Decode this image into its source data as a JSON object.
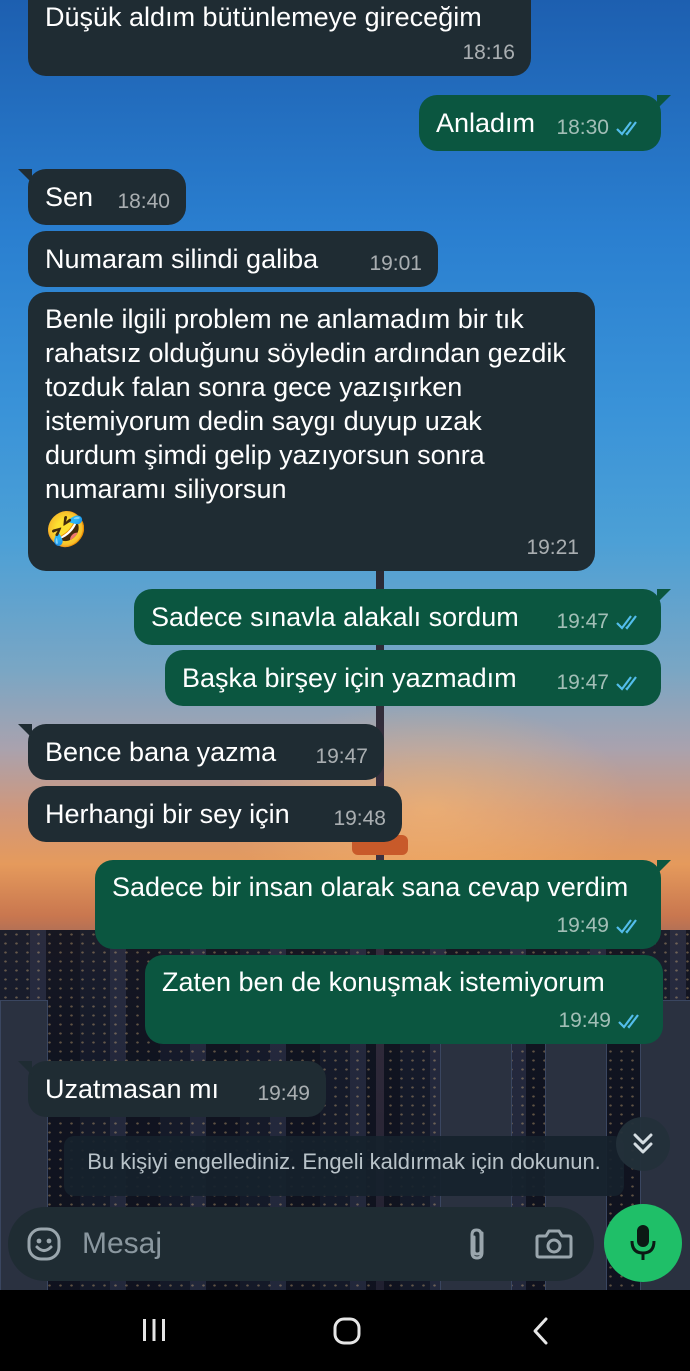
{
  "messages": [
    {
      "side": "in",
      "text": "Düşük aldım bütünlemeye gireceğim",
      "time": "18:16"
    },
    {
      "side": "out",
      "text": "Anladım",
      "time": "18:30",
      "read": true
    },
    {
      "side": "in",
      "text": "Sen",
      "time": "18:40"
    },
    {
      "side": "in",
      "text": "Numaram silindi galiba",
      "time": "19:01"
    },
    {
      "side": "in",
      "text": "Benle ilgili problem ne anlamadım bir tık rahatsız olduğunu söyledin ardından gezdik tozduk falan sonra gece yazışırken istemiyorum dedin saygı duyup uzak durdum şimdi gelip yazıyorsun sonra numaramı siliyorsun",
      "emoji": "🤣",
      "time": "19:21"
    },
    {
      "side": "out",
      "text": "Sadece sınavla alakalı sordum",
      "time": "19:47",
      "read": true
    },
    {
      "side": "out",
      "text": "Başka birşey için yazmadım",
      "time": "19:47",
      "read": true
    },
    {
      "side": "in",
      "text": "Bence bana yazma",
      "time": "19:47"
    },
    {
      "side": "in",
      "text": "Herhangi bir sey için",
      "time": "19:48"
    },
    {
      "side": "out",
      "text": "Sadece bir insan olarak sana cevap verdim",
      "time": "19:49",
      "read": true
    },
    {
      "side": "out",
      "text": "Zaten ben de konuşmak istemiyorum",
      "time": "19:49",
      "read": true
    },
    {
      "side": "in",
      "text": "Uzatmasan mı",
      "time": "19:49"
    }
  ],
  "blocked_notice": "Bu kişiyi engellediniz. Engeli kaldırmak için dokunun.",
  "composer": {
    "placeholder": "Mesaj"
  },
  "icons": {
    "emoji": "emoji-icon",
    "attach": "paperclip-icon",
    "camera": "camera-icon",
    "mic": "mic-icon",
    "scroll": "double-chevron-down-icon",
    "read_receipt": "double-check-icon"
  },
  "colors": {
    "incoming_bubble": "#1f2c33",
    "outgoing_bubble": "#0b5640",
    "read_tick": "#53bdeb",
    "mic_button": "#1fbf68"
  }
}
